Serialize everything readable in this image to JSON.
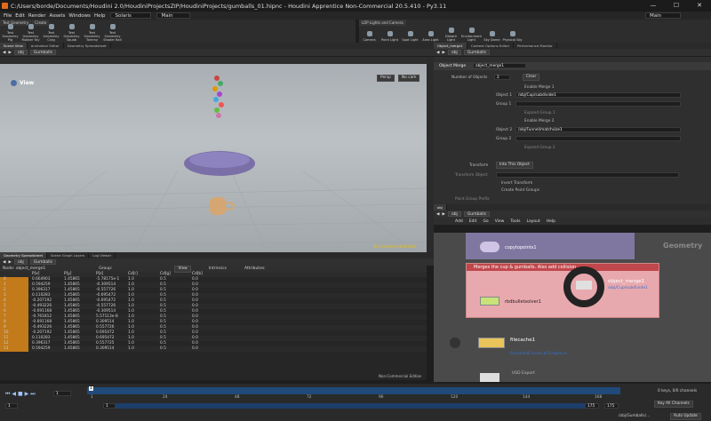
{
  "window": {
    "title": "C:/Users/borde/Documents/Houdini 2.0/HoudiniProjectsZIP/HoudiniProjects/gumballs_01.hipnc - Houdini Apprentice Non-Commercial 20.5.410 - Py3.11",
    "min": "—",
    "max": "☐",
    "close": "✕"
  },
  "menu": {
    "items": [
      "File",
      "Edit",
      "Render",
      "Assets",
      "Windows",
      "Help"
    ],
    "desk": "Solaris",
    "desk2": "Main",
    "desk3": "Main"
  },
  "shelf": {
    "tabs": [
      "Test Geometry",
      "Create"
    ],
    "tools": [
      "Test Geometry Pig",
      "Test Geometry Rubber Toy",
      "Test Geometry Crag",
      "Test Geometry Squab",
      "Test Geometry Tommy",
      "Test Geometry Shader Ball"
    ],
    "tabs2": [
      "LOP Lights and Camera"
    ],
    "tools2": [
      "Camera",
      "Point Light",
      "Spot Light",
      "Area Light",
      "Distant Light",
      "Environment Light",
      "Sky Dome",
      "Physical Sky"
    ]
  },
  "viewer": {
    "tabs": [
      "Scene View",
      "Animation Editor",
      "Geometry Spreadsheet"
    ],
    "path": "obj",
    "node": "Gumballs",
    "label": "View",
    "persp": "Persp",
    "cam": "No cam",
    "watermark": "Non-Commercial Edition"
  },
  "param": {
    "tabs": [
      "Object_merge1",
      "Context Options Editor",
      "Performance Monitor"
    ],
    "path": "obj",
    "node": "Gumballs",
    "type": "Object Merge",
    "name": "object_merge1",
    "num_label": "Number of Objects",
    "num": "2",
    "clear": "Clear",
    "enable1": "Enable Merge 1",
    "obj1_label": "Object 1",
    "obj1": "/obj/Cup/subdivide1",
    "group1_label": "Group 1",
    "expand1": "Expand Group 1",
    "enable2": "Enable Merge 2",
    "obj2_label": "Object 2",
    "obj2": "/obj/Funnel/matchsize1",
    "group2_label": "Group 2",
    "expand2": "Expand Group 2",
    "transform_label": "Transform",
    "transform": "Into This Object",
    "transobj_label": "Transform Object",
    "invert": "Invert Transform",
    "create": "Create Point Groups",
    "pgprefix": "Point Group Prefix"
  },
  "network": {
    "path": "obj",
    "node": "Gumballs",
    "menus": [
      "Add",
      "Edit",
      "Go",
      "View",
      "Tools",
      "Layout",
      "Help"
    ],
    "context": "Geometry",
    "note": "Merges the cup & gumballs. Also add collision",
    "nodes": {
      "copy": "copytopoints1",
      "rbd": "rbdbulletsolver1",
      "merge": "object_merge1",
      "merge_sub": "/obj/Cup/subdivide1",
      "cache": "filecache1",
      "cache_sub": "GumballsFunnel.$F4.bgeo.sc",
      "usd": "USD Export",
      "usd_sub": "GumballsFunnel_SIM..."
    }
  },
  "spreadsheet": {
    "tabs": [
      "Geometry Spreadsheet",
      "Scene Graph Layers",
      "Log Viewer"
    ],
    "path": "obj",
    "node": "Gumballs",
    "nodefield": "Node: object_merge1",
    "group": "Group:",
    "view": "View",
    "intrinsics": "Intrinsics",
    "attributes": "Attributes:",
    "columns": [
      "",
      "P[x]",
      "P[y]",
      "P[z]",
      "Cd[r]",
      "Cd[g]",
      "Cd[b]"
    ],
    "rows": [
      [
        "0",
        "0.664903",
        "1.45865",
        "-5.78175e-1",
        "1.0",
        "0.5",
        "0.0"
      ],
      [
        "1",
        "0.594259",
        "1.45865",
        "-0.309514",
        "1.0",
        "0.5",
        "0.0"
      ],
      [
        "2",
        "0.396317",
        "1.45865",
        "-0.557726",
        "1.0",
        "0.5",
        "0.0"
      ],
      [
        "3",
        "0.110283",
        "1.45865",
        "-0.695472",
        "1.0",
        "0.5",
        "0.0"
      ],
      [
        "4",
        "-0.207192",
        "1.45865",
        "-0.695472",
        "1.0",
        "0.5",
        "0.0"
      ],
      [
        "5",
        "-0.493226",
        "1.45865",
        "-0.557726",
        "1.0",
        "0.5",
        "0.0"
      ],
      [
        "6",
        "-0.691168",
        "1.45865",
        "-0.309514",
        "1.0",
        "0.5",
        "0.0"
      ],
      [
        "7",
        "-0.761812",
        "1.45865",
        "5.57113e-8",
        "1.0",
        "0.5",
        "0.0"
      ],
      [
        "8",
        "-0.691168",
        "1.45865",
        "0.309514",
        "1.0",
        "0.5",
        "0.0"
      ],
      [
        "9",
        "-0.493226",
        "1.45865",
        "0.557726",
        "1.0",
        "0.5",
        "0.0"
      ],
      [
        "10",
        "-0.207192",
        "1.45865",
        "0.695472",
        "1.0",
        "0.5",
        "0.0"
      ],
      [
        "11",
        "0.110283",
        "1.45865",
        "0.695472",
        "1.0",
        "0.5",
        "0.0"
      ],
      [
        "12",
        "0.396317",
        "1.45865",
        "0.557725",
        "1.0",
        "0.5",
        "0.0"
      ],
      [
        "13",
        "0.594259",
        "1.45865",
        "0.309514",
        "1.0",
        "0.5",
        "0.0"
      ]
    ],
    "watermark": "Non-Commercial Edition"
  },
  "timeline": {
    "frame": "1",
    "start": "1",
    "s2": "1",
    "end": "175",
    "e2": "175",
    "ticks": [
      "1",
      "24",
      "48",
      "72",
      "96",
      "120",
      "144",
      "168"
    ],
    "keys": "0 keys, 0/0 channels",
    "keyall": "Key All Channels",
    "path": "/obj/Gumballs/...",
    "autoupdate": "Auto Update"
  }
}
